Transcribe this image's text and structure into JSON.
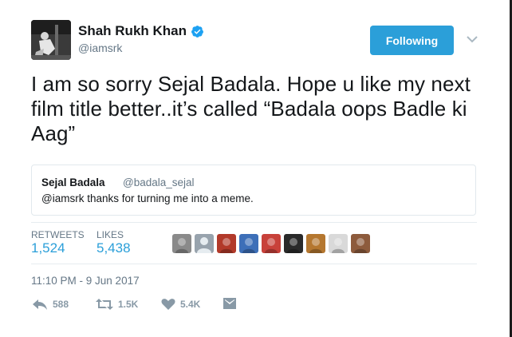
{
  "author": {
    "name": "Shah Rukh Khan",
    "handle": "@iamsrk",
    "verified": true,
    "avatar_icon": "profile-photo"
  },
  "follow_button": {
    "label": "Following",
    "color": "#2b9fd9"
  },
  "tweet": {
    "text": "I am so sorry Sejal Badala. Hope u like my next film title better..it’s called “Badala oops Badle ki Aag”"
  },
  "quoted_tweet": {
    "name": "Sejal Badala",
    "handle": "@badala_sejal",
    "text": "@iamsrk thanks for turning me into a meme."
  },
  "stats": {
    "retweets_label": "RETWEETS",
    "retweets_value": "1,524",
    "likes_label": "LIKES",
    "likes_value": "5,438"
  },
  "likers": [
    {
      "icon": "liker-avatar",
      "color": "#8a8a8a"
    },
    {
      "icon": "liker-avatar-default",
      "color": "#98a3ad"
    },
    {
      "icon": "liker-avatar",
      "color": "#b23a2a"
    },
    {
      "icon": "liker-avatar",
      "color": "#3d6fb8"
    },
    {
      "icon": "liker-avatar",
      "color": "#c8413a"
    },
    {
      "icon": "liker-avatar",
      "color": "#2a2a2a"
    },
    {
      "icon": "liker-avatar",
      "color": "#b5772f"
    },
    {
      "icon": "liker-avatar",
      "color": "#d9d9d9"
    },
    {
      "icon": "liker-avatar",
      "color": "#8d5b3c"
    }
  ],
  "timestamp": "11:10 PM - 9 Jun 2017",
  "actions": {
    "reply_count": "588",
    "retweet_count": "1.5K",
    "like_count": "5.4K"
  }
}
